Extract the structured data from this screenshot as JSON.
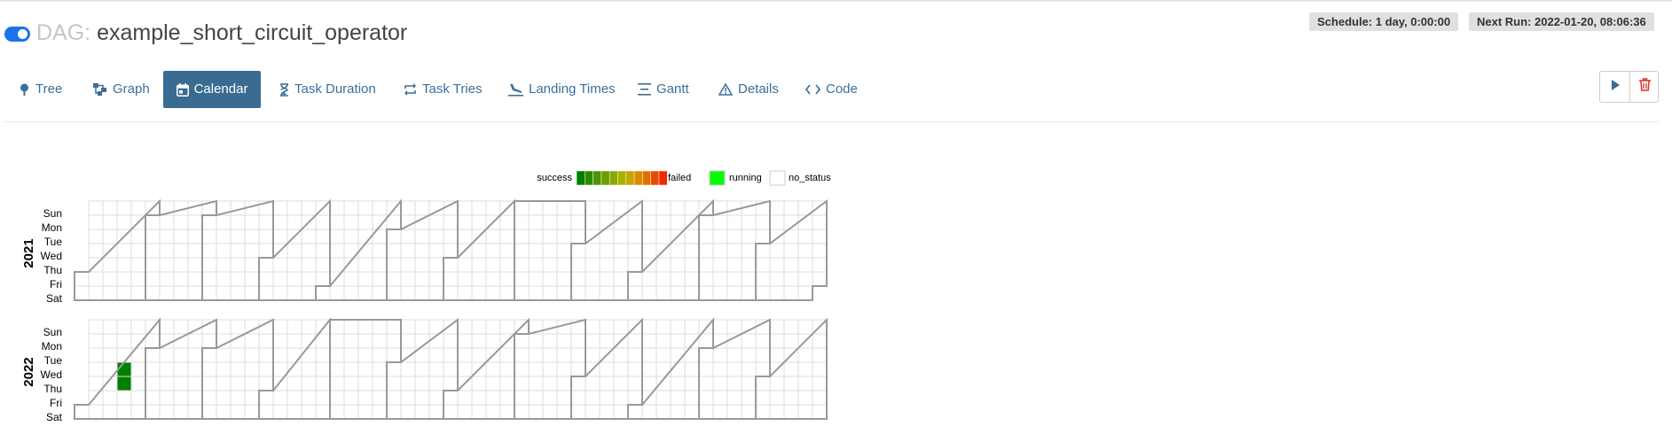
{
  "header": {
    "dag_prefix": "DAG:",
    "dag_name": "example_short_circuit_operator",
    "paused_toggle": "on",
    "schedule": "Schedule: 1 day, 0:00:00",
    "next_run": "Next Run: 2022-01-20, 08:06:36"
  },
  "nav": {
    "tabs": [
      {
        "label": "Tree",
        "icon": "tree-icon"
      },
      {
        "label": "Graph",
        "icon": "graph-icon"
      },
      {
        "label": "Calendar",
        "icon": "calendar-icon",
        "active": true
      },
      {
        "label": "Task Duration",
        "icon": "hourglass-icon"
      },
      {
        "label": "Task Tries",
        "icon": "repeat-icon"
      },
      {
        "label": "Landing Times",
        "icon": "plane-landing-icon"
      },
      {
        "label": "Gantt",
        "icon": "gantt-icon"
      },
      {
        "label": "Details",
        "icon": "warning-icon"
      },
      {
        "label": "Code",
        "icon": "code-icon"
      }
    ],
    "actions": [
      {
        "name": "trigger-dag",
        "icon": "play-icon"
      },
      {
        "name": "delete-dag",
        "icon": "trash-icon"
      }
    ]
  },
  "calendar": {
    "legend": {
      "success_label": "success",
      "failed_label": "failed",
      "running_label": "running",
      "no_status_label": "no_status",
      "gradient_colors": [
        "#008000",
        "#2d8a00",
        "#4c9400",
        "#6b9e00",
        "#8aa800",
        "#a9b000",
        "#c9a300",
        "#d98a00",
        "#e36e00",
        "#e94c00",
        "#ee2a00"
      ],
      "running_color": "#00ff00"
    },
    "weekdays": [
      "Sun",
      "Mon",
      "Tue",
      "Wed",
      "Thu",
      "Fri",
      "Sat"
    ],
    "years": [
      {
        "year": "2021",
        "weeks": 53,
        "first_weekday": 5,
        "cells": []
      },
      {
        "year": "2022",
        "weeks": 53,
        "first_weekday": 6,
        "cells": [
          {
            "date": "2022-01-19",
            "status": "success"
          },
          {
            "date": "2022-01-20",
            "status": "success"
          }
        ]
      }
    ],
    "colors": {
      "success": "#008000",
      "cell_border": "#dddddd",
      "month_border": "#999999"
    }
  }
}
